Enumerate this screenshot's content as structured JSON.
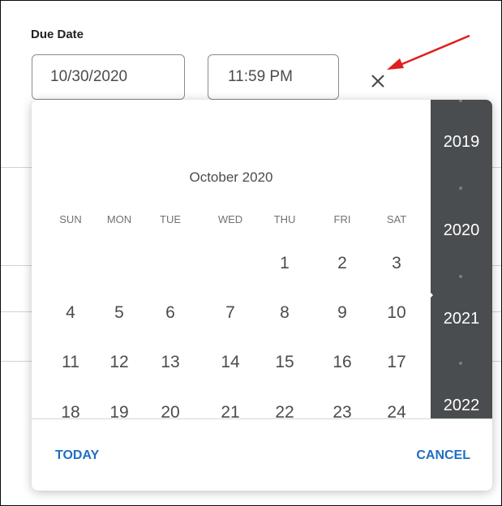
{
  "due_date": {
    "label": "Due Date",
    "date_value": "10/30/2020",
    "time_value": "11:59 PM"
  },
  "colors": {
    "accent": "#1f6ec2",
    "year_strip_bg": "#4a4d50",
    "annotation_arrow": "#e01e1e"
  },
  "calendar": {
    "month_title": "October 2020",
    "weekdays": [
      "SUN",
      "MON",
      "TUE",
      "WED",
      "THU",
      "FRI",
      "SAT"
    ],
    "week1": [
      "",
      "",
      "",
      "",
      "1",
      "2",
      "3"
    ],
    "week2": [
      "4",
      "5",
      "6",
      "7",
      "8",
      "9",
      "10"
    ],
    "week3": [
      "11",
      "12",
      "13",
      "14",
      "15",
      "16",
      "17"
    ],
    "week4": [
      "18",
      "19",
      "20",
      "21",
      "22",
      "23",
      "24"
    ],
    "years": [
      "2019",
      "2020",
      "2021",
      "2022"
    ],
    "today_label": "TODAY",
    "cancel_label": "CANCEL"
  }
}
